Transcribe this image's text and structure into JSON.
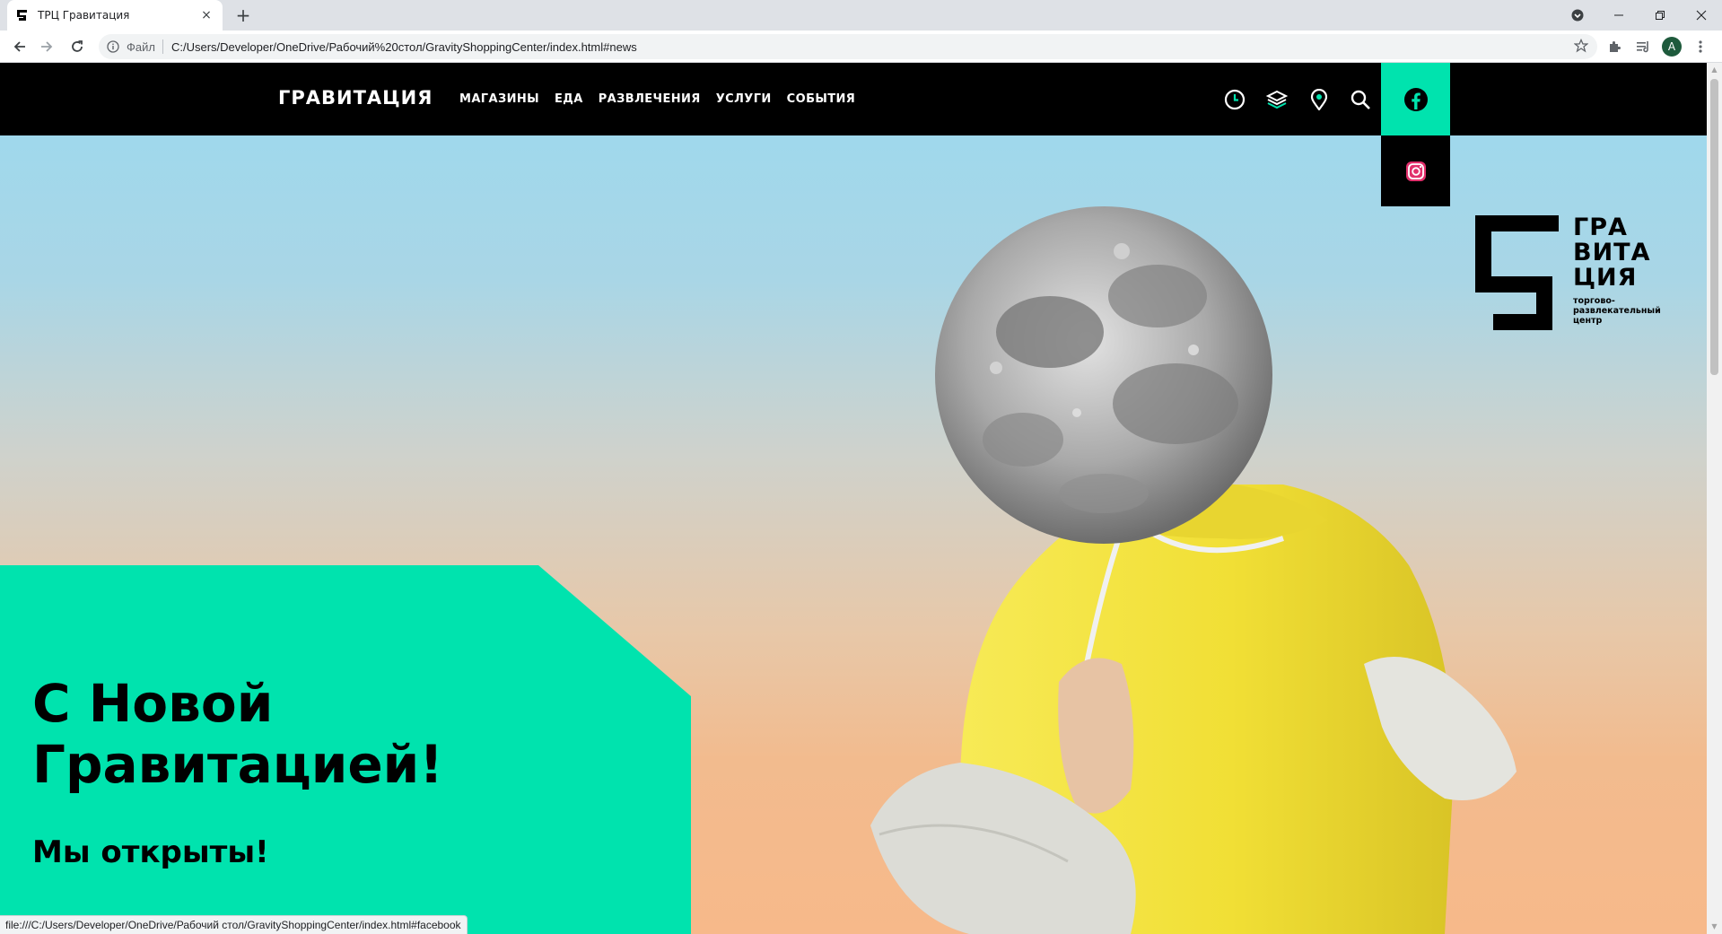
{
  "browser": {
    "tab_title": "ТРЦ Гравитация",
    "tab_close": "×",
    "new_tab": "+",
    "scheme_label": "Файл",
    "url": "C:/Users/Developer/OneDrive/Рабочий%20стол/GravityShoppingCenter/index.html#news",
    "avatar_letter": "A",
    "status_url": "file:///C:/Users/Developer/OneDrive/Рабочий стол/GravityShoppingCenter/index.html#facebook"
  },
  "site": {
    "logo": "ГРАВИТАЦИЯ",
    "nav": [
      {
        "label": "МАГАЗИНЫ"
      },
      {
        "label": "ЕДА"
      },
      {
        "label": "РАЗВЛЕЧЕНИЯ"
      },
      {
        "label": "УСЛУГИ"
      },
      {
        "label": "СОБЫТИЯ"
      }
    ],
    "header_icons": [
      "clock-icon",
      "layers-icon",
      "location-pin-icon",
      "search-icon",
      "facebook-icon",
      "instagram-icon"
    ],
    "brand": {
      "line1": "ГРА",
      "line2": "ВИТА",
      "line3": "ЦИЯ",
      "sub1": "торгово-",
      "sub2": "развлекательный",
      "sub3": "центр"
    },
    "hero": {
      "title_line1": "С Новой",
      "title_line2": "Гравитацией!",
      "subtitle": "Мы открыты!"
    }
  },
  "colors": {
    "accent": "#00e3ae",
    "header_bg": "#000000",
    "hoodie": "#f2e23a",
    "instagram": "#e1306c"
  }
}
